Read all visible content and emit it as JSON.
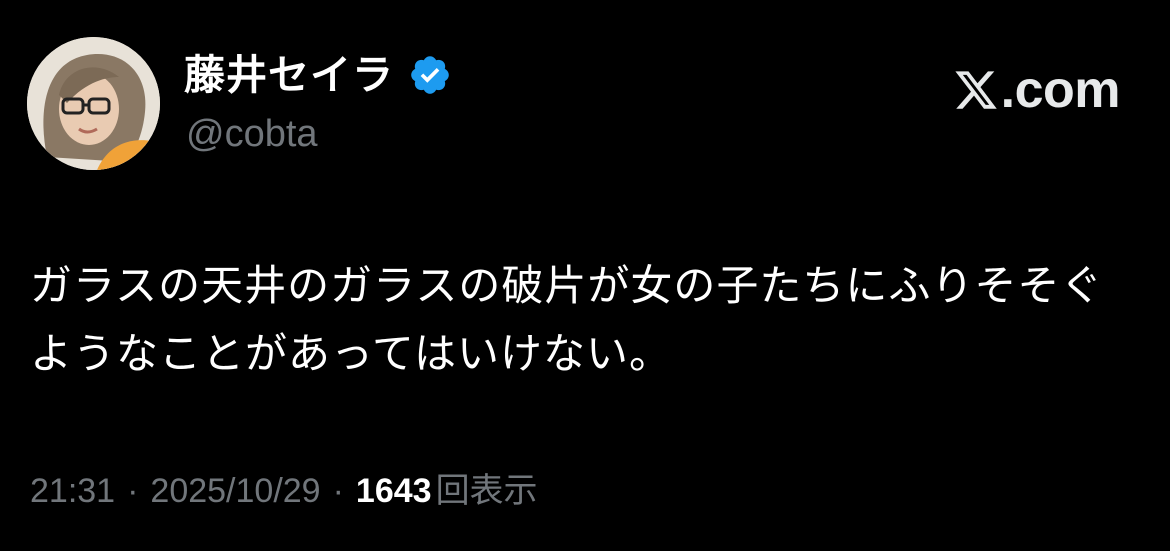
{
  "tweet": {
    "author": {
      "display_name": "藤井セイラ",
      "handle": "@cobta",
      "verified": true,
      "verified_color": "#1d9bf0",
      "avatar_icon": "user-avatar-photo"
    },
    "brand": {
      "icon": "x-logo-icon",
      "text": ".com"
    },
    "text": "ガラスの天井のガラスの破片が女の子たちにふりそそぐようなことがあってはいけない。",
    "meta": {
      "time": "21:31",
      "separator": "·",
      "date": "2025/10/29",
      "views_count": "1643",
      "views_label": "回表示"
    }
  },
  "colors": {
    "background": "#000000",
    "primary_text": "#ffffff",
    "secondary_text": "#71767b",
    "verified_blue": "#1d9bf0"
  }
}
